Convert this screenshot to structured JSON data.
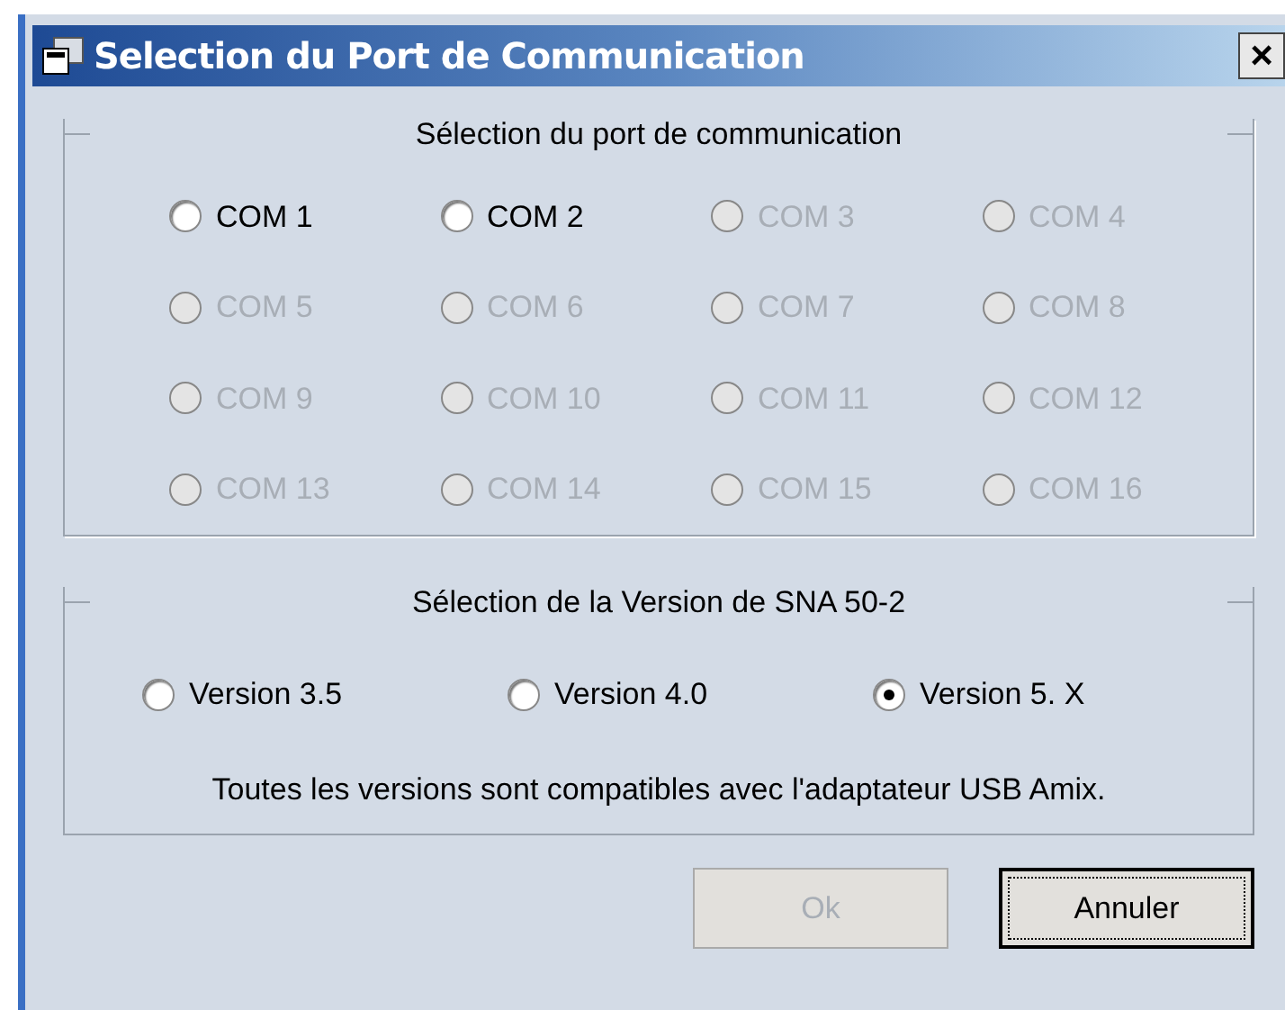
{
  "window": {
    "title": "Selection du Port de Communication",
    "close": "×"
  },
  "port_group": {
    "title": "Sélection du port de communication",
    "ports": [
      {
        "label": "COM 1",
        "selected": false,
        "disabled": false
      },
      {
        "label": "COM 2",
        "selected": false,
        "disabled": false
      },
      {
        "label": "COM 3",
        "selected": false,
        "disabled": true
      },
      {
        "label": "COM 4",
        "selected": false,
        "disabled": true
      },
      {
        "label": "COM 5",
        "selected": false,
        "disabled": true
      },
      {
        "label": "COM 6",
        "selected": false,
        "disabled": true
      },
      {
        "label": "COM 7",
        "selected": false,
        "disabled": true
      },
      {
        "label": "COM 8",
        "selected": false,
        "disabled": true
      },
      {
        "label": "COM 9",
        "selected": false,
        "disabled": true
      },
      {
        "label": "COM 10",
        "selected": false,
        "disabled": true
      },
      {
        "label": "COM 11",
        "selected": false,
        "disabled": true
      },
      {
        "label": "COM 12",
        "selected": false,
        "disabled": true
      },
      {
        "label": "COM 13",
        "selected": false,
        "disabled": true
      },
      {
        "label": "COM 14",
        "selected": false,
        "disabled": true
      },
      {
        "label": "COM 15",
        "selected": false,
        "disabled": true
      },
      {
        "label": "COM 16",
        "selected": false,
        "disabled": true
      }
    ]
  },
  "version_group": {
    "title": "Sélection de la Version de SNA 50-2",
    "versions": [
      {
        "label": "Version 3.5",
        "selected": false
      },
      {
        "label": "Version 4.0",
        "selected": false
      },
      {
        "label": "Version 5. X",
        "selected": true
      }
    ],
    "note": "Toutes les versions sont compatibles avec l'adaptateur USB Amix."
  },
  "buttons": [
    {
      "label": "Ok",
      "disabled": true,
      "focused": false
    },
    {
      "label": "Annuler",
      "disabled": false,
      "focused": true
    }
  ]
}
